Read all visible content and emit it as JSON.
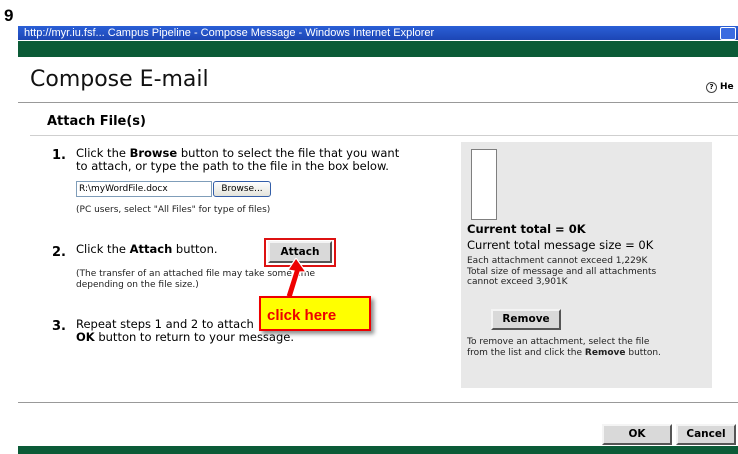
{
  "figure": {
    "step_number": "9"
  },
  "window": {
    "title": "http://myr.iu.fsf...  Campus Pipeline - Compose Message - Windows Internet Explorer"
  },
  "header": {
    "title": "Compose E-mail",
    "help_icon": "?",
    "help_label": "He"
  },
  "section": {
    "title": "Attach File(s)"
  },
  "steps": {
    "s1": {
      "num": "1.",
      "line1_a": "Click the ",
      "line1_bold": "Browse",
      "line1_b": " button to select the file that you want",
      "line2": "to attach, or type the path to the file in the box below.",
      "file_value": "R:\\myWordFile.docx",
      "browse_label": "Browse...",
      "note": "(PC users, select \"All Files\" for type of files)"
    },
    "s2": {
      "num": "2.",
      "text_a": "Click the ",
      "text_bold": "Attach",
      "text_b": " button.",
      "attach_label": "Attach",
      "note_line1": "(The transfer of an attached file may take some time",
      "note_line2": "depending on the file size.)"
    },
    "s3": {
      "num": "3.",
      "line1_a": "Repeat steps 1 and 2 to attach",
      "line1_b": "the",
      "line2_bold": "OK",
      "line2_rest": " button to return to your message."
    }
  },
  "callout": {
    "text": "click here",
    "color": "#ee0000"
  },
  "attachments": {
    "current_total": "Current total = 0K",
    "current_size": "Current total message size = 0K",
    "limit1": "Each attachment cannot exceed 1,229K",
    "limit2": "Total size of message and all attachments",
    "limit3": "cannot exceed 3,901K",
    "remove_label": "Remove",
    "remove_help_a": "To remove an attachment, select the file",
    "remove_help_b": "from the list and click the ",
    "remove_help_bold": "Remove",
    "remove_help_c": " button."
  },
  "footer": {
    "ok_label": "OK",
    "cancel_label": "Cancel"
  },
  "colors": {
    "header_green": "#0b5b37",
    "highlight_red": "#dd1111",
    "callout_yellow": "#ffff00"
  }
}
